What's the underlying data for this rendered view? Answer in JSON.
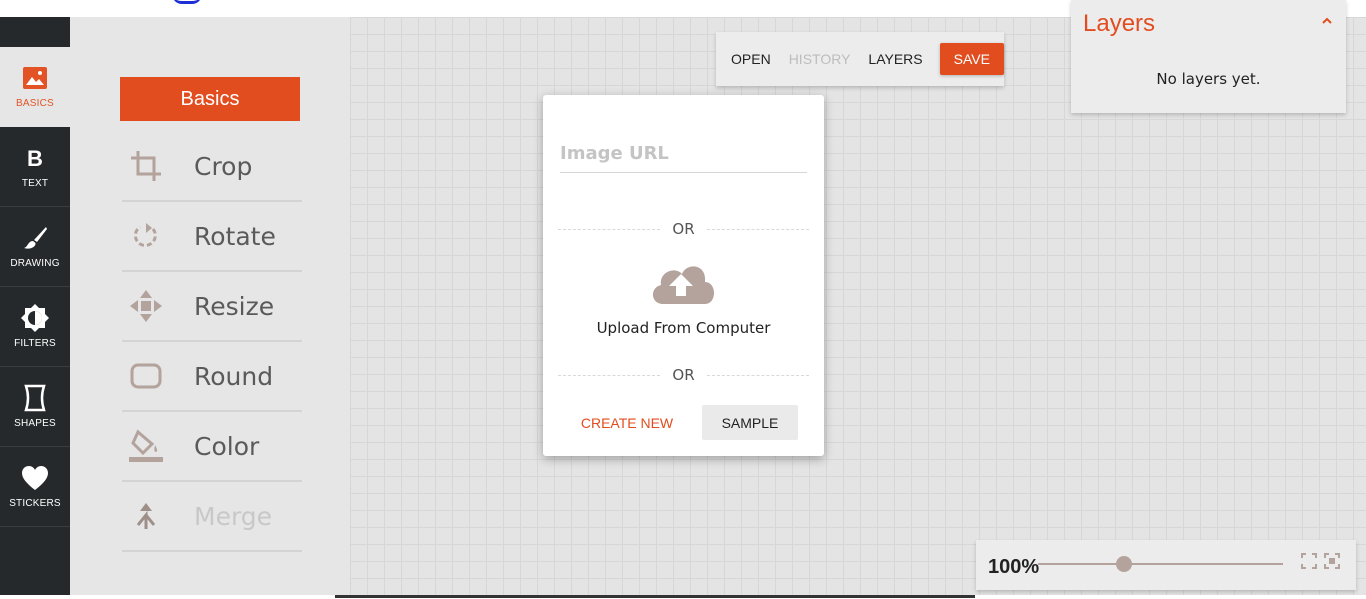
{
  "nav": {
    "items": [
      {
        "label": "BASICS",
        "icon": "image-icon"
      },
      {
        "label": "TEXT",
        "icon": "bold-icon"
      },
      {
        "label": "DRAWING",
        "icon": "brush-icon"
      },
      {
        "label": "FILTERS",
        "icon": "brightness-icon"
      },
      {
        "label": "SHAPES",
        "icon": "shape-icon"
      },
      {
        "label": "STICKERS",
        "icon": "heart-icon"
      }
    ]
  },
  "tools": {
    "title": "Basics",
    "items": [
      {
        "label": "Crop",
        "icon": "crop-icon"
      },
      {
        "label": "Rotate",
        "icon": "rotate-icon"
      },
      {
        "label": "Resize",
        "icon": "resize-icon"
      },
      {
        "label": "Round",
        "icon": "round-corners-icon"
      },
      {
        "label": "Color",
        "icon": "paint-bucket-icon"
      },
      {
        "label": "Merge",
        "icon": "merge-icon"
      }
    ]
  },
  "toolbar": {
    "open": "OPEN",
    "history": "HISTORY",
    "layers": "LAYERS",
    "save": "SAVE"
  },
  "layers_panel": {
    "title": "Layers",
    "empty_text": "No layers yet."
  },
  "dialog": {
    "url_placeholder": "Image URL",
    "or_1": "OR",
    "upload_label": "Upload From Computer",
    "or_2": "OR",
    "create_new": "CREATE NEW",
    "sample": "SAMPLE"
  },
  "zoom": {
    "value": "100%",
    "slider_fraction": 0.35
  },
  "colors": {
    "accent": "#e24d20",
    "nav_bg": "#26292c",
    "panel_bg": "#e6e6e6",
    "muted_icon": "#b3a39c"
  }
}
